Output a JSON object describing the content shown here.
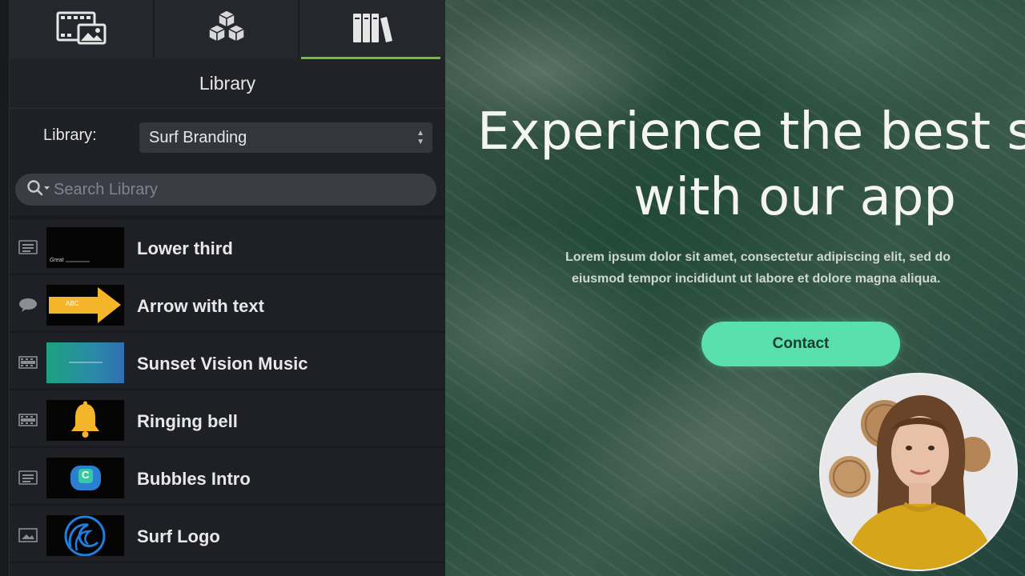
{
  "tabs": [
    {
      "icon": "media-icon"
    },
    {
      "icon": "annotations-icon"
    },
    {
      "icon": "library-icon"
    }
  ],
  "panel": {
    "title": "Library",
    "library_label": "Library:",
    "library_selected": "Surf Branding",
    "search_placeholder": "Search Library"
  },
  "items": [
    {
      "label": "Lower third",
      "type_icon": "callout-icon",
      "thumb_text": "Great"
    },
    {
      "label": "Arrow with text",
      "type_icon": "speech-bubble-icon",
      "thumb_text": "ABC"
    },
    {
      "label": "Sunset Vision Music",
      "type_icon": "filmstrip-icon",
      "thumb_text": ""
    },
    {
      "label": "Ringing bell",
      "type_icon": "filmstrip-icon",
      "thumb_text": ""
    },
    {
      "label": "Bubbles Intro",
      "type_icon": "callout-icon",
      "thumb_text": "C"
    },
    {
      "label": "Surf Logo",
      "type_icon": "image-icon",
      "thumb_text": ""
    }
  ],
  "video": {
    "headline_line1": "Experience the best s",
    "headline_line2": "with our app",
    "lorem_line1": "Lorem ipsum dolor sit amet, consectetur adipiscing elit, sed do",
    "lorem_line2": "eiusmod tempor incididunt ut labore et dolore magna aliqua.",
    "contact_label": "Contact"
  },
  "colors": {
    "accent_tab": "#6fbf2f",
    "contact_button": "#5ae0ad",
    "panel_bg": "#1e2025"
  }
}
